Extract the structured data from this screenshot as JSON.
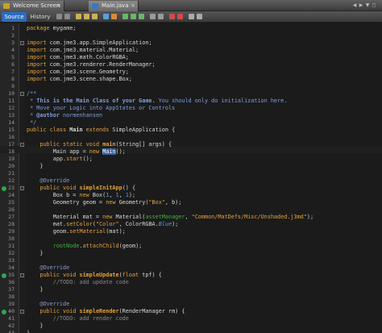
{
  "tabs": [
    {
      "label": "Welcome Screen",
      "close": "×"
    },
    {
      "label": "Main.java",
      "close": "×"
    }
  ],
  "tabnav": [
    "◀",
    "▶",
    "▼",
    "◻"
  ],
  "toolbar": {
    "source": "Source",
    "history": "History"
  },
  "code_lines": [
    {
      "n": "1",
      "html": "<span class='kw'>package</span> mygame;"
    },
    {
      "n": "2",
      "html": ""
    },
    {
      "n": "3",
      "html": "<span class='kw'>import</span> com.jme3.app.SimpleApplication;"
    },
    {
      "n": "4",
      "html": "<span class='kw'>import</span> com.jme3.material.Material;"
    },
    {
      "n": "5",
      "html": "<span class='kw'>import</span> com.jme3.math.ColorRGBA;"
    },
    {
      "n": "6",
      "html": "<span class='kw'>import</span> com.jme3.renderer.RenderManager;"
    },
    {
      "n": "7",
      "html": "<span class='kw'>import</span> com.jme3.scene.Geometry;"
    },
    {
      "n": "8",
      "html": "<span class='kw'>import</span> com.jme3.scene.shape.Box;"
    },
    {
      "n": "9",
      "html": ""
    },
    {
      "n": "10",
      "html": "<span class='jd'>/**</span>"
    },
    {
      "n": "11",
      "html": "<span class='jd'> * <span class='jdb'>This is the Main Class of your Game.</span> You should only do initialization here.</span>"
    },
    {
      "n": "12",
      "html": "<span class='jd'> * Move your Logic into AppStates or Controls</span>"
    },
    {
      "n": "13",
      "html": "<span class='jd'> * <b>@author</b> normenhansen</span>"
    },
    {
      "n": "14",
      "html": "<span class='jd'> */</span>"
    },
    {
      "n": "15",
      "html": "<span class='kw'>public class</span> <b>Main</b> <span class='kw'>extends</span> SimpleApplication {"
    },
    {
      "n": "16",
      "html": ""
    },
    {
      "n": "17",
      "html": "    <span class='kw'>public static void</span> <span class='meth'><b>main</b></span>(String[] args) {"
    },
    {
      "n": "18",
      "html": "        Main app = <span class='kw'>new</span> <span class='hl'>Main</span>();"
    },
    {
      "n": "19",
      "html": "        app.<span class='meth'>start</span>();"
    },
    {
      "n": "20",
      "html": "    }"
    },
    {
      "n": "21",
      "html": ""
    },
    {
      "n": "22",
      "html": "    <span class='ann'>@Override</span>"
    },
    {
      "n": "23",
      "html": "    <span class='kw'>public void</span> <span class='meth'><b>simpleInitApp</b></span>() {"
    },
    {
      "n": "24",
      "html": "        Box b = <span class='kw'>new</span> Box(<span class='num'>1</span>, <span class='num'>1</span>, <span class='num'>1</span>);"
    },
    {
      "n": "25",
      "html": "        Geometry geom = <span class='kw'>new</span> Geometry(<span class='str'>\"Box\"</span>, b);"
    },
    {
      "n": "26",
      "html": ""
    },
    {
      "n": "27",
      "html": "        Material mat = <span class='kw'>new</span> Material(<span class='fld'>assetManager</span>, <span class='str'>\"Common/MatDefs/Misc/Unshaded.j3md\"</span>);"
    },
    {
      "n": "28",
      "html": "        mat.<span class='meth'>setColor</span>(<span class='str'>\"Color\"</span>, ColorRGBA.<span class='num'><i>Blue</i></span>);"
    },
    {
      "n": "29",
      "html": "        geom.<span class='meth'>setMaterial</span>(mat);"
    },
    {
      "n": "30",
      "html": ""
    },
    {
      "n": "31",
      "html": "        <span class='fld'>rootNode</span>.<span class='meth'>attachChild</span>(geom);"
    },
    {
      "n": "32",
      "html": "    }"
    },
    {
      "n": "33",
      "html": ""
    },
    {
      "n": "34",
      "html": "    <span class='ann'>@Override</span>"
    },
    {
      "n": "35",
      "html": "    <span class='kw'>public void</span> <span class='meth'><b>simpleUpdate</b></span>(<span class='kw'>float</span> tpf) {"
    },
    {
      "n": "36",
      "html": "        <span class='cm'>//TODO: add update code</span>"
    },
    {
      "n": "37",
      "html": "    }"
    },
    {
      "n": "38",
      "html": ""
    },
    {
      "n": "39",
      "html": "    <span class='ann'>@Override</span>"
    },
    {
      "n": "40",
      "html": "    <span class='kw'>public void</span> <span class='meth'><b>simpleRender</b></span>(RenderManager rm) {"
    },
    {
      "n": "41",
      "html": "        <span class='cm'>//TODO: add render code</span>"
    },
    {
      "n": "42",
      "html": "    }"
    },
    {
      "n": "43",
      "html": "}"
    }
  ],
  "markers": [
    "23",
    "35",
    "40"
  ],
  "folds": [
    "3",
    "10",
    "17",
    "23",
    "35",
    "40"
  ]
}
